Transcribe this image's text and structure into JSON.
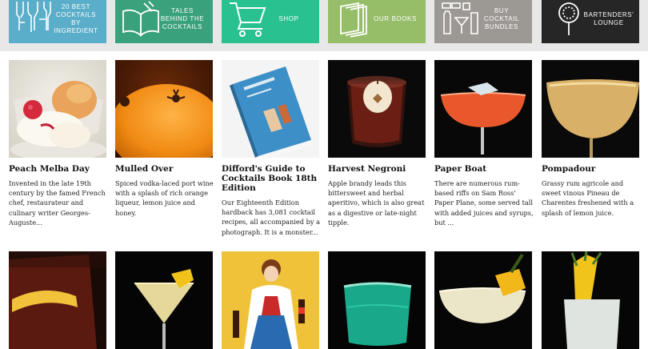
{
  "nav_tiles": [
    {
      "label": "20 Best Cocktails by Ingredient",
      "color": "#5aaec9",
      "icon": "bottles-icon"
    },
    {
      "label": "Tales Behind the Cocktails",
      "color": "#3aa17d",
      "icon": "open-book-icon"
    },
    {
      "label": "Shop",
      "color": "#29c18f",
      "icon": "shopping-cart-icon"
    },
    {
      "label": "Our Books",
      "color": "#96bd68",
      "icon": "books-icon"
    },
    {
      "label": "Buy Cocktail Bundles",
      "color": "#9c9894",
      "icon": "bottle-bundle-icon"
    },
    {
      "label": "Bartenders' Lounge",
      "color": "#262626",
      "icon": "strainer-icon"
    }
  ],
  "cards": [
    {
      "title": "Peach Melba Day",
      "desc": "Invented in the late 19th century by the famed French chef, restaurateur and culinary writer Georges-Auguste...",
      "image": "peach-melba-image"
    },
    {
      "title": "Mulled Over",
      "desc": "Spiced vodka-laced port wine with a splash of rich orange liqueur, lemon juice and honey.",
      "image": "clove-orange-image"
    },
    {
      "title": "Difford's Guide to Cocktails Book 18th Edition",
      "desc": "Our Eighteenth Edition hardback has 3,081 cocktail recipes, all accompanied by a photograph. It is a monster...",
      "image": "book-cover-image"
    },
    {
      "title": "Harvest Negroni",
      "desc": "Apple brandy leads this bittersweet and herbal aperitivo, which is also great as a digestive or late-night tipple.",
      "image": "negroni-glass-image"
    },
    {
      "title": "Paper Boat",
      "desc": "There are numerous rum-based riffs on Sam Ross' Paper Plane, some served tall with added juices and syrups, but ...",
      "image": "coupe-cocktail-image"
    },
    {
      "title": "Pompadour",
      "desc": "Grassy rum agricole and sweet vinous Pineau de Charentes freshened with a splash of lemon juice.",
      "image": "pompadour-glass-image"
    }
  ],
  "bottom_row": [
    {
      "image": "old-fashioned-image"
    },
    {
      "image": "martini-lemon-image"
    },
    {
      "image": "vintage-poster-image"
    },
    {
      "image": "blue-cocktail-image"
    },
    {
      "image": "pineapple-coupe-image"
    },
    {
      "image": "highball-pineapple-image"
    }
  ]
}
